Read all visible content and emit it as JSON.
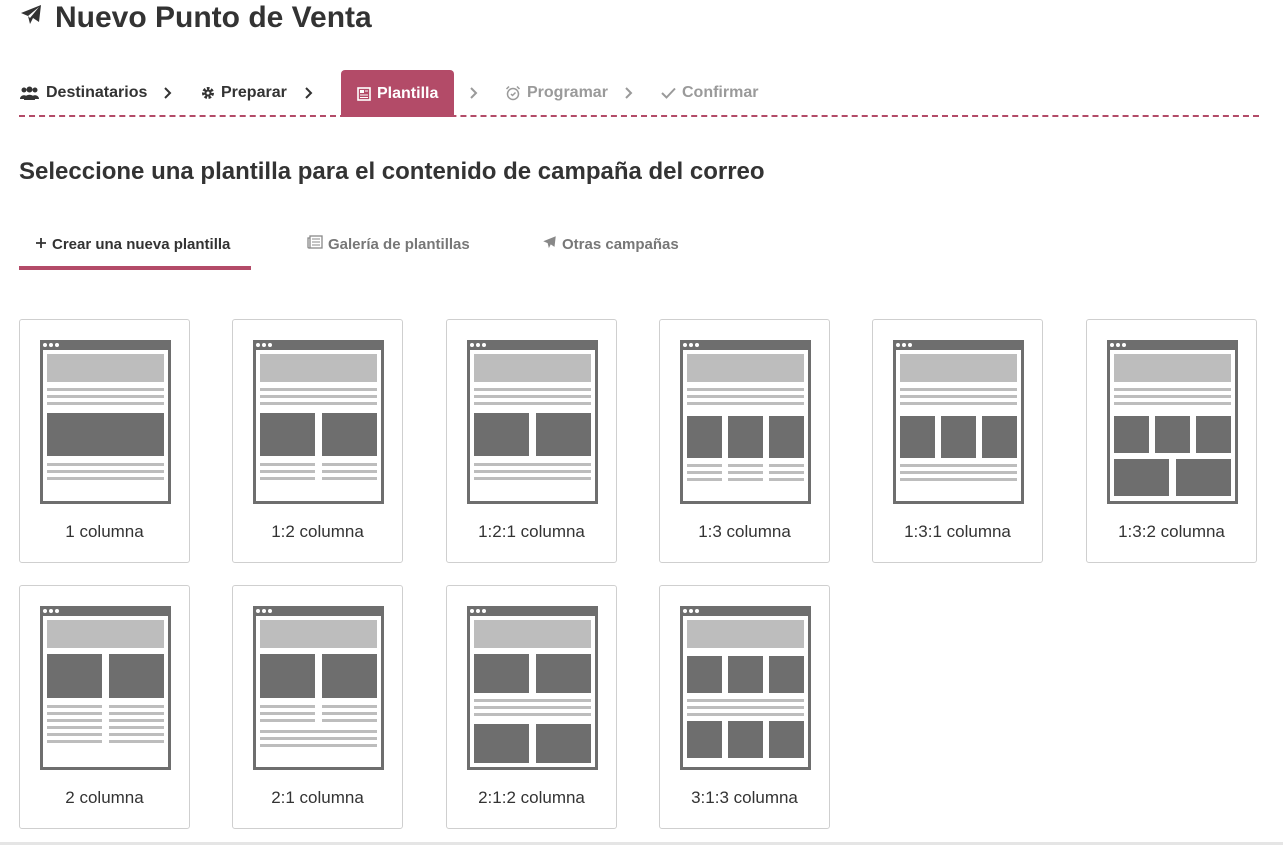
{
  "header": {
    "title": "Nuevo Punto de Venta",
    "icon": "paper-plane-icon"
  },
  "steps": [
    {
      "label": "Destinatarios",
      "icon": "users-icon",
      "state": "done"
    },
    {
      "label": "Preparar",
      "icon": "gear-icon",
      "state": "done"
    },
    {
      "label": "Plantilla",
      "icon": "newspaper-icon",
      "state": "active"
    },
    {
      "label": "Programar",
      "icon": "alarm-clock-icon",
      "state": "todo"
    },
    {
      "label": "Confirmar",
      "icon": "check-icon",
      "state": "todo"
    }
  ],
  "subtitle": "Seleccione una plantilla para el contenido de campaña del correo",
  "tabs": [
    {
      "label": "Crear una nueva plantilla",
      "icon": "plus-icon",
      "active": true
    },
    {
      "label": "Galería de plantillas",
      "icon": "newspaper-icon",
      "active": false
    },
    {
      "label": "Otras campañas",
      "icon": "paper-plane-icon",
      "active": false
    }
  ],
  "templates": [
    {
      "label": "1 columna"
    },
    {
      "label": "1:2 columna"
    },
    {
      "label": "1:2:1 columna"
    },
    {
      "label": "1:3 columna"
    },
    {
      "label": "1:3:1 columna"
    },
    {
      "label": "1:3:2 columna"
    },
    {
      "label": "2 columna"
    },
    {
      "label": "2:1 columna"
    },
    {
      "label": "2:1:2 columna"
    },
    {
      "label": "3:1:3 columna"
    }
  ],
  "colors": {
    "accent": "#b34b68",
    "thumb_dark": "#6e6e6e",
    "thumb_light": "#bdbdbd"
  }
}
